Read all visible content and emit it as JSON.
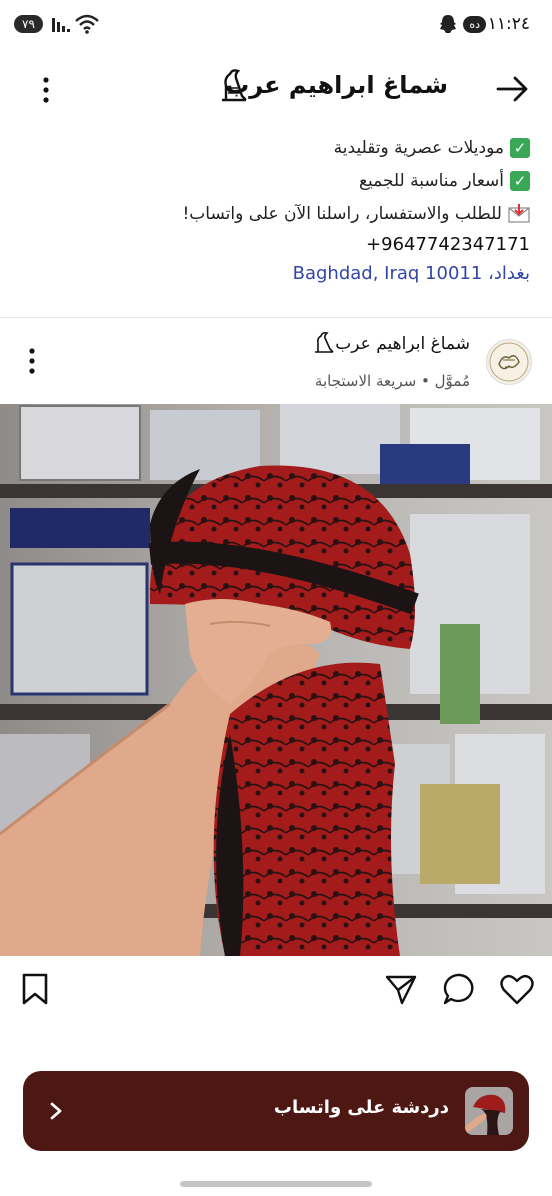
{
  "status_bar": {
    "time": "١١:٢٤",
    "battery": "٧٩",
    "pill": "ده"
  },
  "header": {
    "title": "شماغ ابراهيم عرب",
    "back_icon": "arrow-right-icon",
    "menu_icon": "kebab-icon"
  },
  "bio": {
    "line1": "موديلات عصرية وتقليدية",
    "line2": "أسعار مناسبة للجميع",
    "line3": "للطلب والاستفسار، راسلنا الآن على واتساب!",
    "phone": "+9647742347171",
    "location": "بغداد، Baghdad, Iraq 10011"
  },
  "post": {
    "author": "شماغ ابراهيم عرب",
    "subtitle": "مُموَّل • سريعة الاستجابة"
  },
  "actions": {
    "icons": [
      "heart-icon",
      "comment-icon",
      "share-icon",
      "bookmark-icon"
    ]
  },
  "cta": {
    "label": "دردشة على واتساب"
  },
  "colors": {
    "cta_bg": "#4d1714",
    "link": "#3346a8",
    "check": "#3aa757"
  }
}
